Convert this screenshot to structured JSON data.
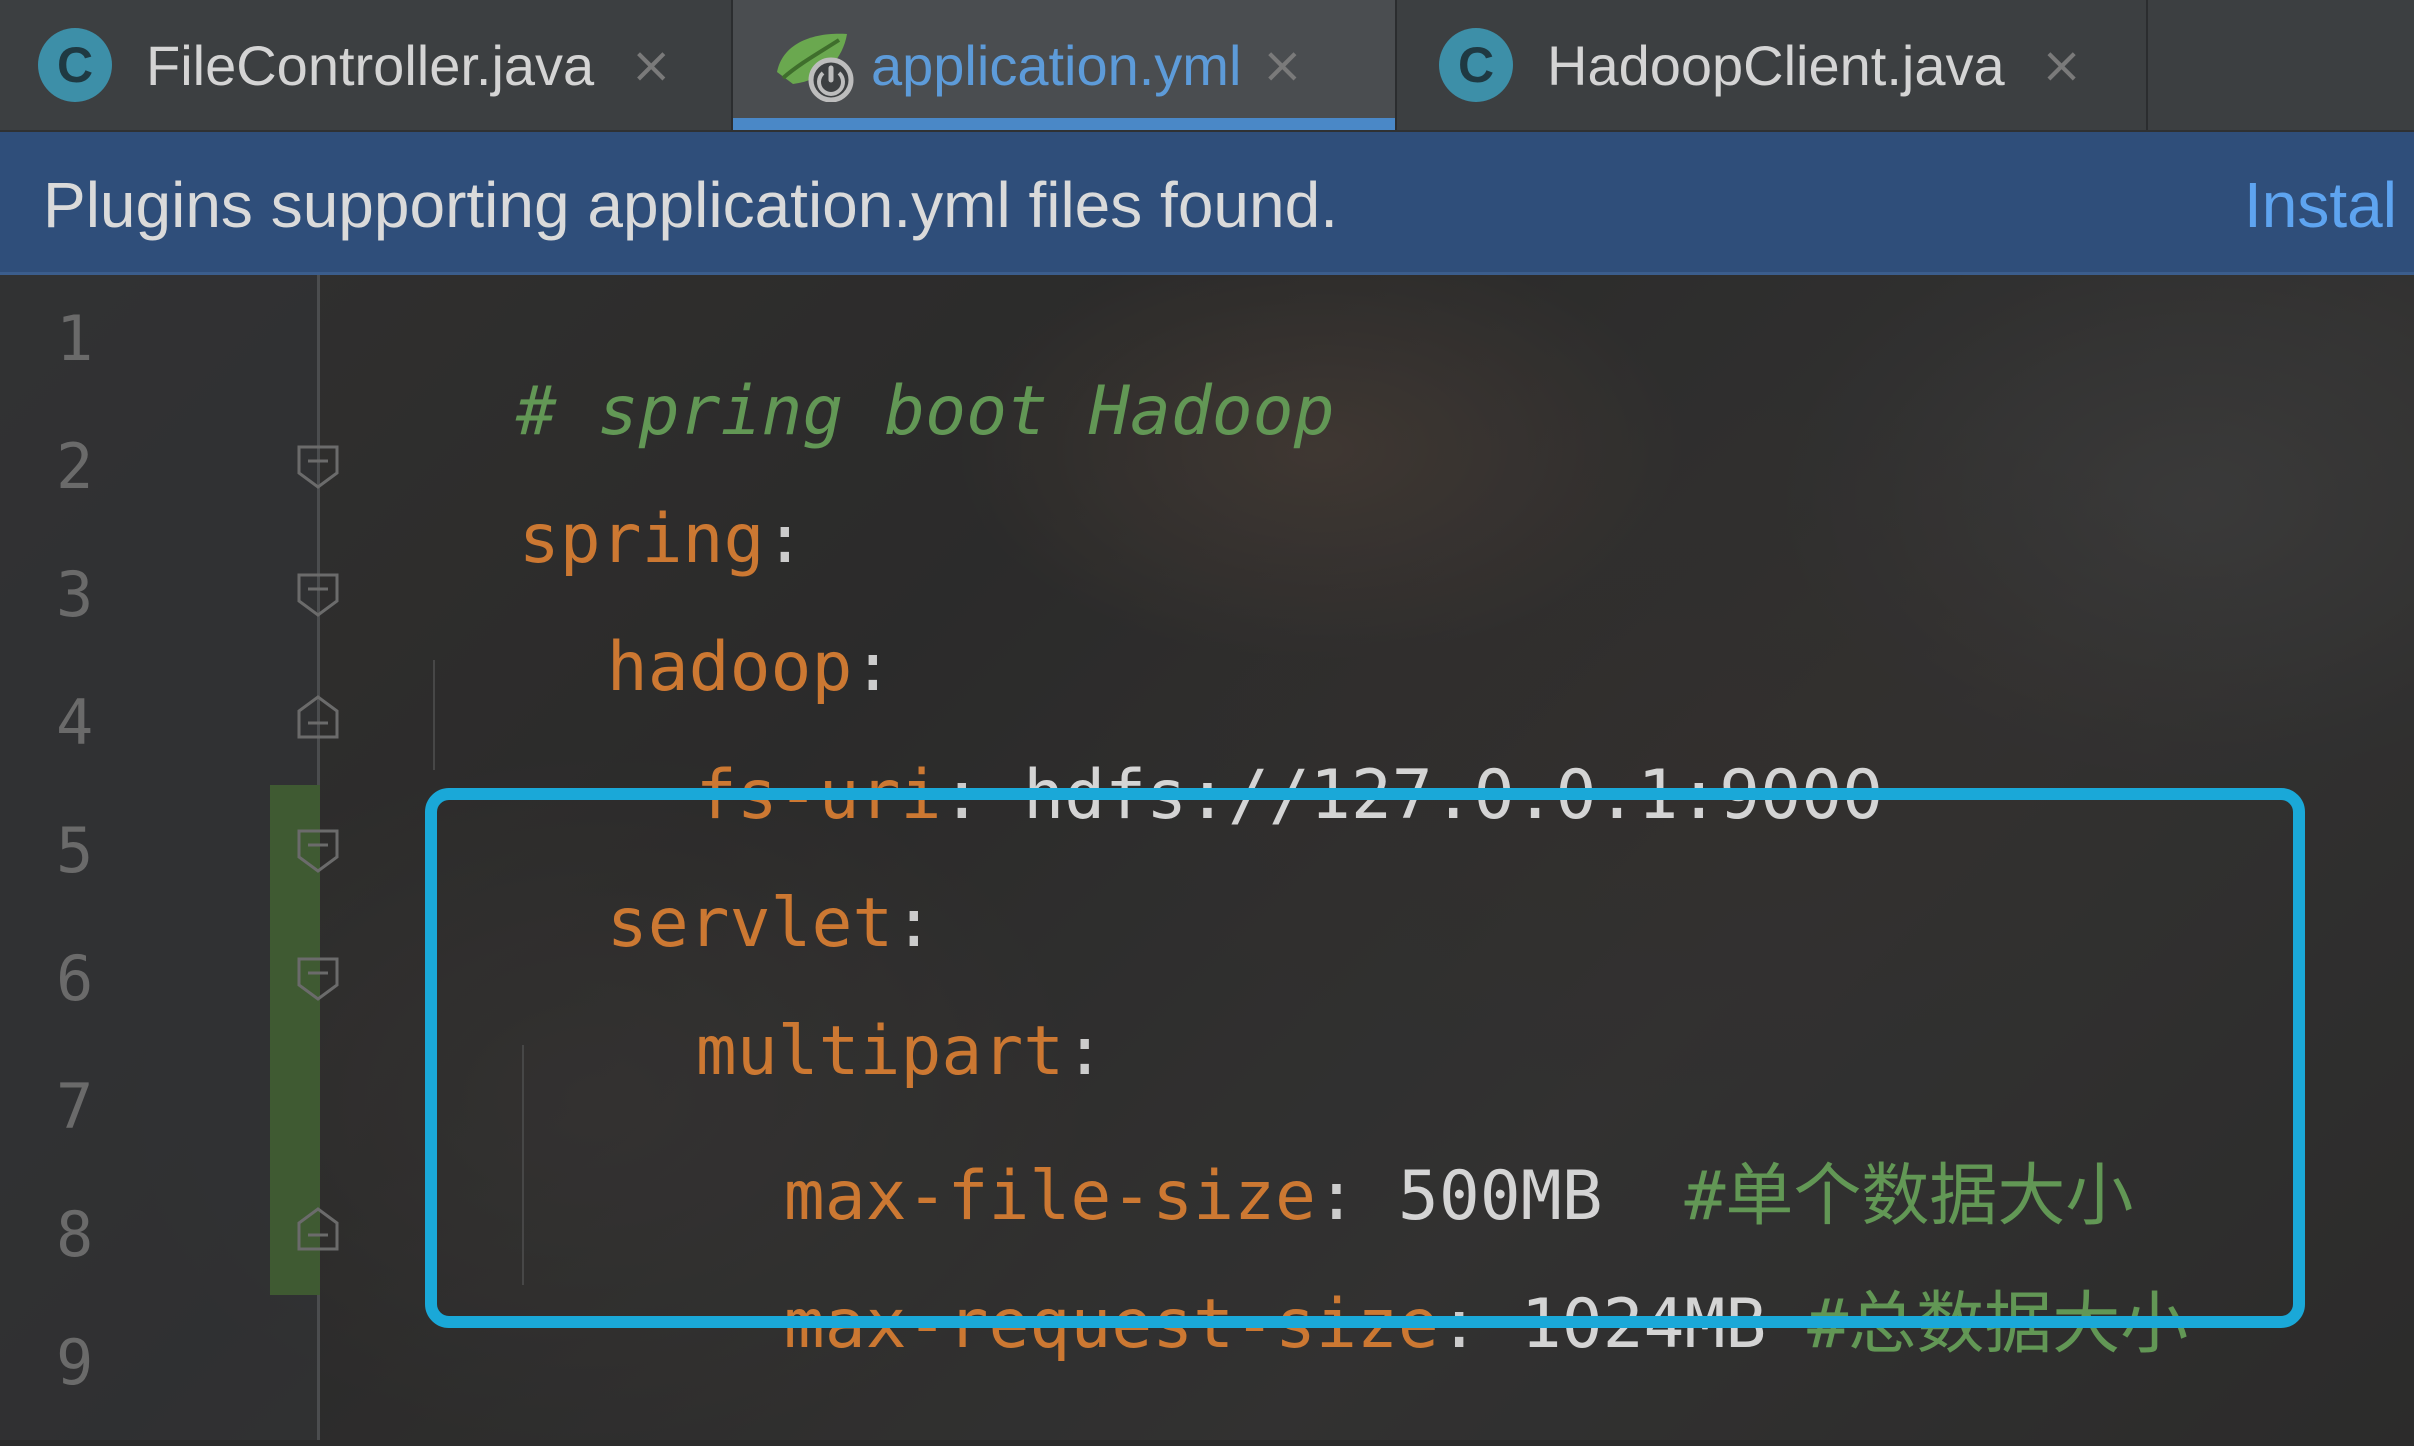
{
  "tabs": [
    {
      "label": "FileController.java",
      "icon": "class-icon",
      "icon_letter": "C",
      "active": false
    },
    {
      "label": "application.yml",
      "icon": "spring-yaml-icon",
      "active": true
    },
    {
      "label": "HadoopClient.java",
      "icon": "class-icon",
      "icon_letter": "C",
      "active": false
    }
  ],
  "close_glyph": "×",
  "banner": {
    "message": "Plugins supporting application.yml files found.",
    "action": "Instal"
  },
  "editor": {
    "line_numbers": [
      "1",
      "2",
      "3",
      "4",
      "5",
      "6",
      "7",
      "8",
      "9"
    ],
    "lines": [
      {
        "comment": "# spring boot Hadoop"
      },
      {
        "key": "spring",
        "colon": ":"
      },
      {
        "key": "hadoop",
        "colon": ":"
      },
      {
        "key": "fs-uri",
        "colon": ":",
        "value": " hdfs://127.0.0.1:9000"
      },
      {
        "key": "servlet",
        "colon": ":"
      },
      {
        "key": "multipart",
        "colon": ":"
      },
      {
        "key": "max-file-size",
        "colon": ":",
        "value": " 500MB  ",
        "comment": "#单个数据大小"
      },
      {
        "key": "max-request-size",
        "colon": ":",
        "value": " 1024MB ",
        "comment": "#总数据大小"
      },
      {}
    ]
  },
  "colors": {
    "yaml_key": "#cc7832",
    "comment": "#629755",
    "highlight_border": "#1aa8d8",
    "banner_bg": "#2f4e7a",
    "active_tab_underline": "#4a88c7"
  }
}
